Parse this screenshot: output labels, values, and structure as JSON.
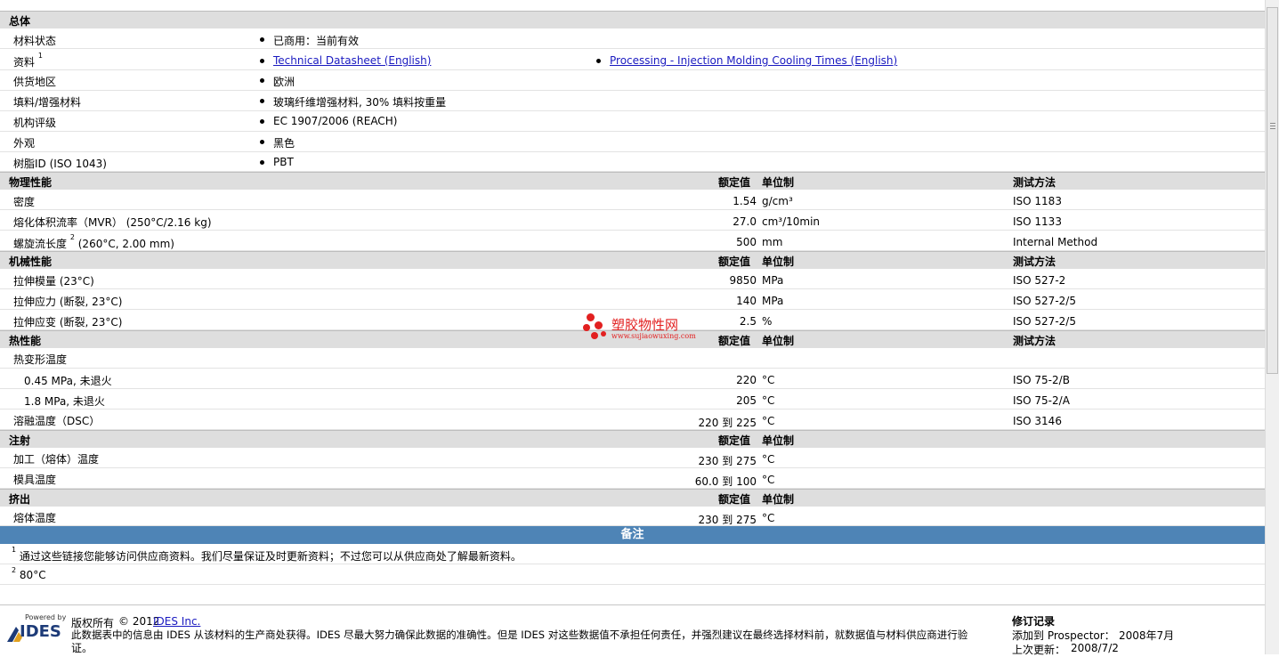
{
  "general": {
    "title": "总体",
    "rows": [
      {
        "label": "材料状态",
        "value": "已商用：当前有效"
      },
      {
        "label": "资料",
        "sup": "1",
        "links": [
          "Technical Datasheet (English)",
          "Processing - Injection Molding Cooling Times (English)"
        ]
      },
      {
        "label": "供货地区",
        "value": "欧洲"
      },
      {
        "label": "填料/增强材料",
        "value": "玻璃纤维增强材料, 30% 填料按重量"
      },
      {
        "label": "机构评级",
        "value": "EC 1907/2006 (REACH)"
      },
      {
        "label": "外观",
        "value": "黑色"
      },
      {
        "label": "树脂ID (ISO 1043)",
        "value": "PBT"
      }
    ]
  },
  "col_headers": {
    "nominal": "额定值",
    "unit": "单位制",
    "method": "测试方法"
  },
  "physical": {
    "title": "物理性能",
    "rows": [
      {
        "label": "密度",
        "value": "1.54",
        "unit": "g/cm³",
        "method": "ISO 1183"
      },
      {
        "label": "熔化体积流率（MVR） (250°C/2.16 kg)",
        "value": "27.0",
        "unit": "cm³/10min",
        "method": "ISO 1133"
      },
      {
        "label": "螺旋流长度",
        "sup": "2",
        "label_suffix": " (260°C, 2.00 mm)",
        "value": "500",
        "unit": "mm",
        "method": "Internal Method"
      }
    ]
  },
  "mechanical": {
    "title": "机械性能",
    "rows": [
      {
        "label": "拉伸模量 (23°C)",
        "value": "9850",
        "unit": "MPa",
        "method": "ISO 527-2"
      },
      {
        "label": "拉伸应力 (断裂, 23°C)",
        "value": "140",
        "unit": "MPa",
        "method": "ISO 527-2/5"
      },
      {
        "label": "拉伸应变 (断裂, 23°C)",
        "value": "2.5",
        "unit": "%",
        "method": "ISO 527-2/5"
      }
    ]
  },
  "thermal": {
    "title": "热性能",
    "rows": [
      {
        "label": "热变形温度",
        "value": "",
        "unit": "",
        "method": ""
      },
      {
        "label": "0.45 MPa, 未退火",
        "value": "220",
        "unit": "°C",
        "method": "ISO 75-2/B"
      },
      {
        "label": "1.8 MPa, 未退火",
        "value": "205",
        "unit": "°C",
        "method": "ISO 75-2/A"
      },
      {
        "label": "溶融温度（DSC）",
        "value_from": "220",
        "to": "到",
        "value_to": "225",
        "unit": "°C",
        "method": "ISO 3146"
      }
    ]
  },
  "injection": {
    "title": "注射",
    "rows": [
      {
        "label": "加工（熔体）温度",
        "value_from": "230",
        "to": "到",
        "value_to": "275",
        "unit": "°C"
      },
      {
        "label": "模具温度",
        "value_from": "60.0",
        "to": "到",
        "value_to": "100",
        "unit": "°C"
      }
    ]
  },
  "extrusion": {
    "title": "挤出",
    "rows": [
      {
        "label": "熔体温度",
        "value_from": "230",
        "to": "到",
        "value_to": "275",
        "unit": "°C"
      }
    ]
  },
  "notes": {
    "title": "备注",
    "items": [
      {
        "sup": "1",
        "text": "通过这些链接您能够访问供应商资料。我们尽量保证及时更新资料；不过您可以从供应商处了解最新资料。"
      },
      {
        "sup": "2",
        "text": "80°C"
      }
    ]
  },
  "watermark": {
    "name": "塑胶物性网",
    "url": "www.sujiaowuxing.com"
  },
  "footer": {
    "logo_top": "Powered by",
    "logo_text": "IDES",
    "copyright_label": "版权所有",
    "copyright_text": "© 2012",
    "copyright_link": "IDES Inc.",
    "disclaimer_line1": "此数据表中的信息由 IDES 从该材料的生产商处获得。IDES 尽最大努力确保此数据的准确性。但是 IDES 对这些数据值不承担任何责任，并强烈建议在最终选择材料前，就数据值与材料供应商进行验",
    "disclaimer_line2": "证。",
    "revision_title": "修订记录",
    "added_label": "添加到 Prospector：",
    "added_value": "2008年7月",
    "updated_label": "上次更新：",
    "updated_value": "2008/7/2"
  }
}
